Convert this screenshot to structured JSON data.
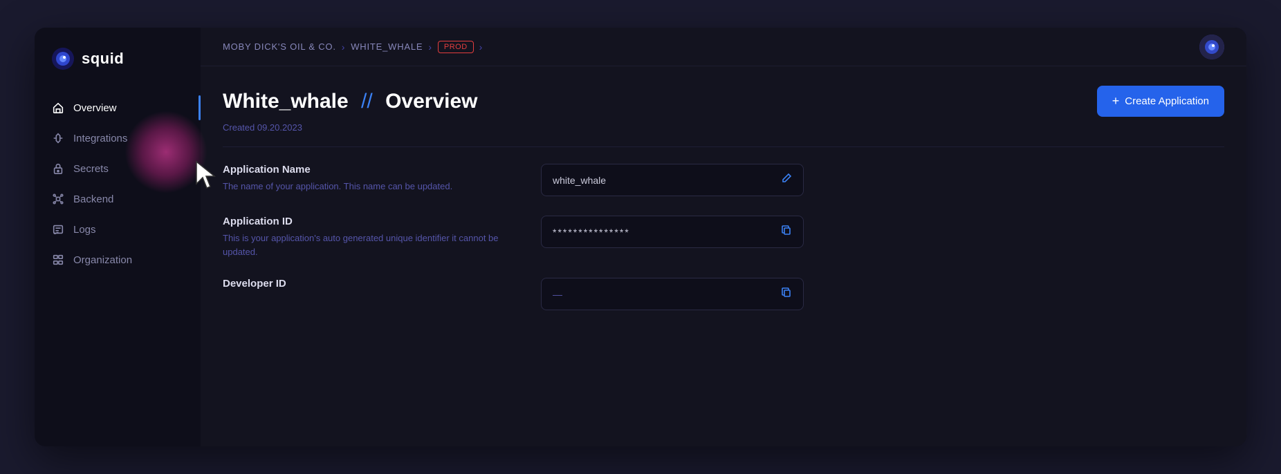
{
  "window": {
    "title": "Squid - White_whale Overview"
  },
  "sidebar": {
    "logo_text": "squid",
    "items": [
      {
        "id": "overview",
        "label": "Overview",
        "active": true
      },
      {
        "id": "integrations",
        "label": "Integrations",
        "active": false
      },
      {
        "id": "secrets",
        "label": "Secrets",
        "active": false
      },
      {
        "id": "backend",
        "label": "Backend",
        "active": false
      },
      {
        "id": "logs",
        "label": "Logs",
        "active": false
      },
      {
        "id": "organization",
        "label": "Organization",
        "active": false
      }
    ]
  },
  "breadcrumb": {
    "org": "MOBY DICK'S OIL & CO.",
    "app": "WHITE_WHALE",
    "env": "prod"
  },
  "page": {
    "title_app": "White_whale",
    "title_section": "Overview",
    "created": "Created 09.20.2023",
    "create_button": "Create Application"
  },
  "form": {
    "fields": [
      {
        "id": "app-name",
        "label": "Application Name",
        "description": "The name of your application. This name can be updated.",
        "value": "white_whale",
        "icon": "edit",
        "masked": false
      },
      {
        "id": "app-id",
        "label": "Application ID",
        "description": "This is your application's auto generated unique identifier it cannot be updated.",
        "value": "***************",
        "icon": "copy",
        "masked": true
      },
      {
        "id": "developer-id",
        "label": "Developer ID",
        "description": "",
        "value": "",
        "icon": "copy",
        "masked": false
      }
    ]
  }
}
